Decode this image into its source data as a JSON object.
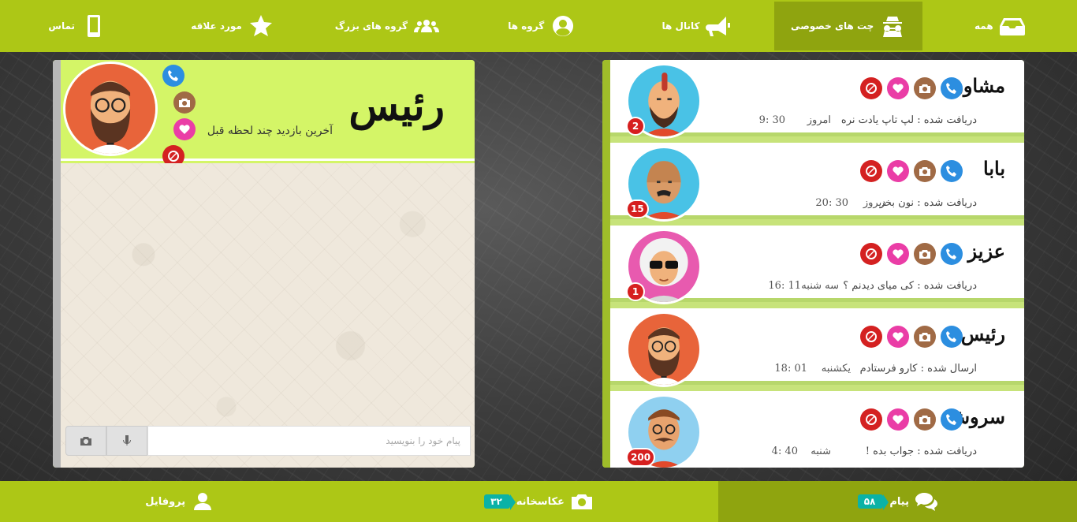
{
  "top_nav": {
    "tabs": [
      {
        "label": "همه",
        "icon": "inbox-icon"
      },
      {
        "label": "چت های خصوصی",
        "icon": "incognito-icon",
        "active": true
      },
      {
        "label": "کانال ها",
        "icon": "megaphone-icon"
      },
      {
        "label": "گروه ها",
        "icon": "user-circle-icon"
      },
      {
        "label": "گروه های بزرگ",
        "icon": "users-icon"
      },
      {
        "label": "مورد علاقه",
        "icon": "star-icon"
      },
      {
        "label": "تماس",
        "icon": "phone-icon"
      }
    ]
  },
  "contacts": [
    {
      "name": "مشاور",
      "status": "دریافت شده : لپ تاپ یادت نره",
      "day": "امروز",
      "time": "30 :9",
      "count": "2",
      "avatar": "mohawk-man"
    },
    {
      "name": "بابا",
      "status": "دریافت شده : نون بخر",
      "day": "دیروز",
      "time": "30 :20",
      "count": "15",
      "avatar": "bald-man"
    },
    {
      "name": "عزیز",
      "status": "دریافت شده : کی میای دیدنم ؟",
      "day": "سه شنبه",
      "time": "11 :16",
      "count": "1",
      "avatar": "grandma"
    },
    {
      "name": "رئیس",
      "status": "ارسال شده : کارو فرستادم",
      "day": "یکشنبه",
      "time": "01 :18",
      "count": "",
      "avatar": "bearded-man"
    },
    {
      "name": "سروش",
      "status": "دریافت شده : جواب بده !",
      "day": "شنبه",
      "time": "40 :4",
      "count": "200",
      "avatar": "mustache-man"
    }
  ],
  "chat": {
    "name": "رئیس",
    "last_seen": "آخرین بازدید چند لحظه قبل",
    "input_placeholder": "پیام خود را بنویسید"
  },
  "bottom_nav": {
    "messages_label": "پیام",
    "messages_count": "۵۸",
    "gallery_label": "عکاسخانه",
    "gallery_count": "۳۲",
    "profile_label": "پروفایل"
  },
  "colors": {
    "nav_green": "#adc716",
    "nav_active": "#8fa40f",
    "chat_header": "#d4f567",
    "badge_teal": "#0bb2a6",
    "call_blue": "#2c8ee0",
    "camera_brown": "#a06a45",
    "heart_pink": "#ea3da6",
    "block_red": "#d42121"
  }
}
